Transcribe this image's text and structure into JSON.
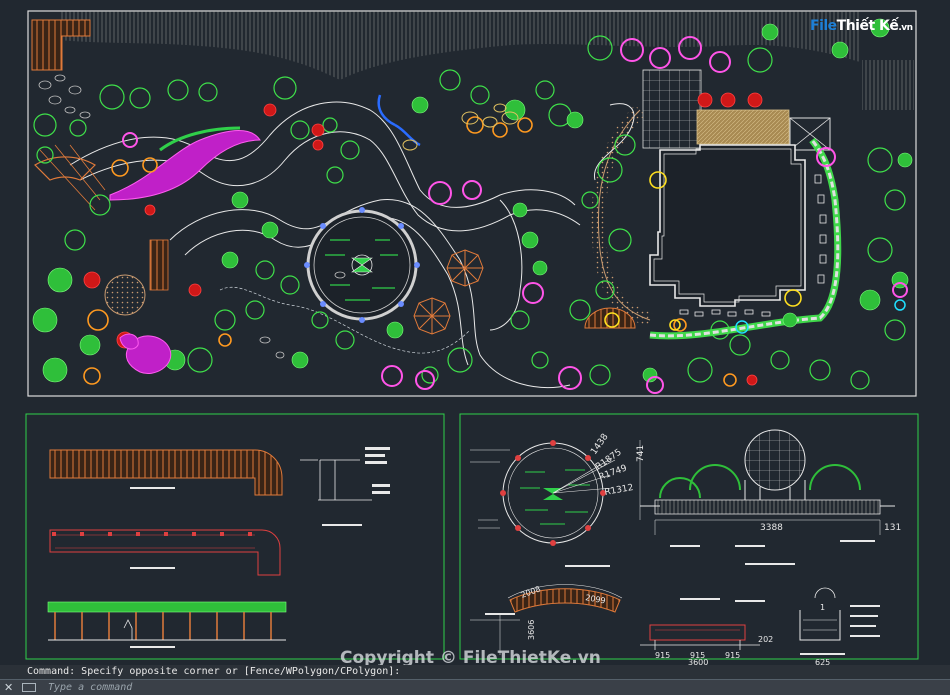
{
  "command_line": {
    "history": "Command: Specify opposite corner or [Fence/WPolygon/CPolygon]:",
    "placeholder": "Type a command"
  },
  "logo": {
    "part1": "File",
    "part2": "Thiết Kế",
    "suffix": ".vn"
  },
  "watermark": "Copyright © FileThietKe.vn",
  "dimensions_text": [
    "1438",
    "R1875",
    "R1749",
    "R1312",
    "741",
    "3388",
    "131",
    "2008",
    "2099",
    "3606",
    "915",
    "915",
    "915",
    "3600",
    "202",
    "625",
    "1"
  ]
}
